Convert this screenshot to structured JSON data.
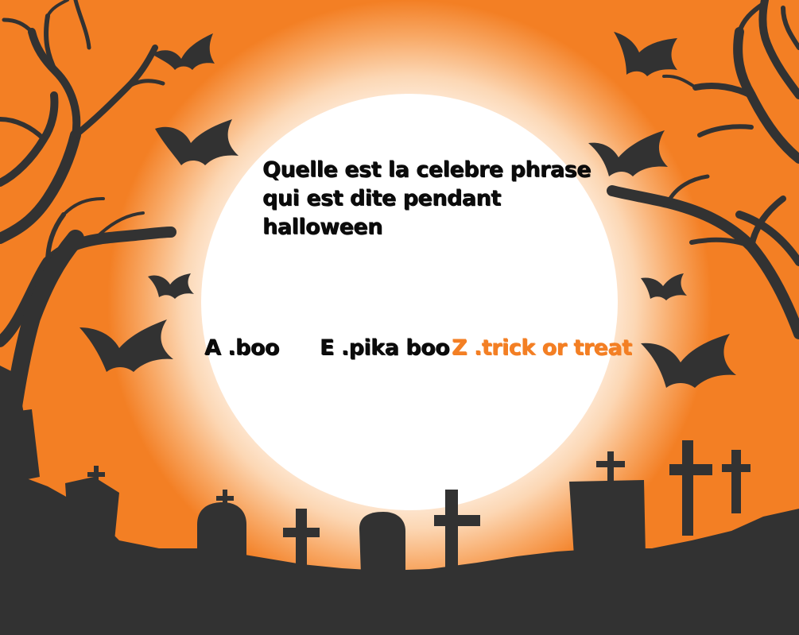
{
  "colors": {
    "background": "#f37f24",
    "moon_center": "#ffffff",
    "moon_glow": "#fcd7b4",
    "silhouette": "#323232",
    "question_text": "#0b0b0b",
    "correct_answer": "#f37f24"
  },
  "question": {
    "lines": [
      "Quelle est la celebre phrase",
      "qui est dite pendant",
      "halloween"
    ]
  },
  "answers": [
    {
      "letter": "A",
      "text": "A .boo"
    },
    {
      "letter": "E",
      "text": "E .pika boo"
    },
    {
      "letter": "Z",
      "text": "Z .trick or treat"
    }
  ]
}
